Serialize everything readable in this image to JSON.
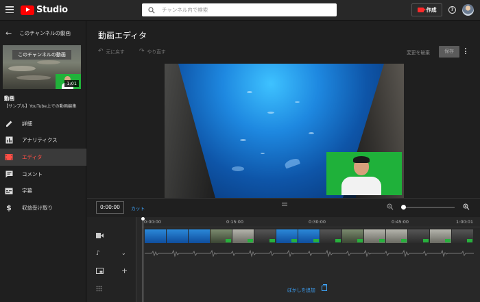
{
  "app": {
    "name": "Studio"
  },
  "search": {
    "placeholder": "チャンネル内で検索"
  },
  "header": {
    "create_label": "作成",
    "help_label": "?"
  },
  "sidebar": {
    "back_label": "このチャンネルの動画",
    "thumbnail": {
      "overlay_text": "このチャンネルの動画",
      "duration": "1:01"
    },
    "video_title": "動画",
    "video_subtitle": "【サンプル】YouTube上での動画編集",
    "items": [
      {
        "label": "詳細",
        "icon": "pencil-icon"
      },
      {
        "label": "アナリティクス",
        "icon": "analytics-icon"
      },
      {
        "label": "エディタ",
        "icon": "film-icon",
        "active": true
      },
      {
        "label": "コメント",
        "icon": "comment-icon"
      },
      {
        "label": "字幕",
        "icon": "subtitles-icon"
      },
      {
        "label": "収益受け取り",
        "icon": "dollar-icon"
      }
    ]
  },
  "editor": {
    "title": "動画エディタ",
    "undo_label": "元に戻す",
    "redo_label": "やり直す",
    "discard_label": "変更を破棄",
    "save_label": "保存"
  },
  "timeline": {
    "current_time": "0:00:00",
    "cut_label": "カット",
    "ticks": [
      "0:00:00",
      "0:15:00",
      "0:30:00",
      "0:45:00",
      "1:00:01"
    ],
    "blur_label": "ぼかしを追加"
  },
  "colors": {
    "accent": "#3ea6ff",
    "active": "#ff4e45",
    "brand": "#ff0000"
  }
}
